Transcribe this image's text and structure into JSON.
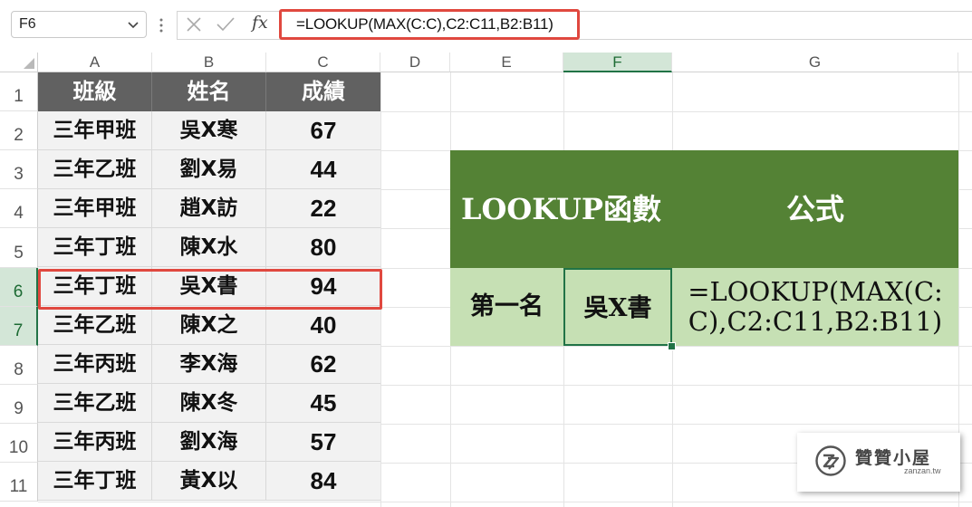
{
  "formula_bar": {
    "name_box": "F6",
    "fx": "fx",
    "formula": "=LOOKUP(MAX(C:C),C2:C11,B2:B11)"
  },
  "columns": [
    "A",
    "B",
    "C",
    "D",
    "E",
    "F",
    "G"
  ],
  "rows": [
    "1",
    "2",
    "3",
    "4",
    "5",
    "6",
    "7",
    "8",
    "9",
    "10",
    "11"
  ],
  "table": {
    "headers": [
      "班級",
      "姓名",
      "成績"
    ],
    "rows": [
      [
        "三年甲班",
        "吳X寒",
        "67"
      ],
      [
        "三年乙班",
        "劉X易",
        "44"
      ],
      [
        "三年甲班",
        "趙X訪",
        "22"
      ],
      [
        "三年丁班",
        "陳X水",
        "80"
      ],
      [
        "三年丁班",
        "吳X書",
        "94"
      ],
      [
        "三年乙班",
        "陳X之",
        "40"
      ],
      [
        "三年丙班",
        "李X海",
        "62"
      ],
      [
        "三年乙班",
        "陳X冬",
        "45"
      ],
      [
        "三年丙班",
        "劉X海",
        "57"
      ],
      [
        "三年丁班",
        "黃X以",
        "84"
      ]
    ]
  },
  "result": {
    "header_left": "LOOKUP函數",
    "header_right": "公式",
    "label": "第一名",
    "value": "吳X書",
    "formula_line1": "=LOOKUP(MAX(C:",
    "formula_line2": "C),C2:C11,B2:B11)"
  },
  "logo": {
    "title": "贊贊小屋",
    "subtitle": "zanzan.tw"
  },
  "colors": {
    "accent_red": "#e0483f",
    "header_gray": "#616161",
    "green_dark": "#548235",
    "green_light": "#c6e0b4",
    "excel_green": "#217346"
  }
}
